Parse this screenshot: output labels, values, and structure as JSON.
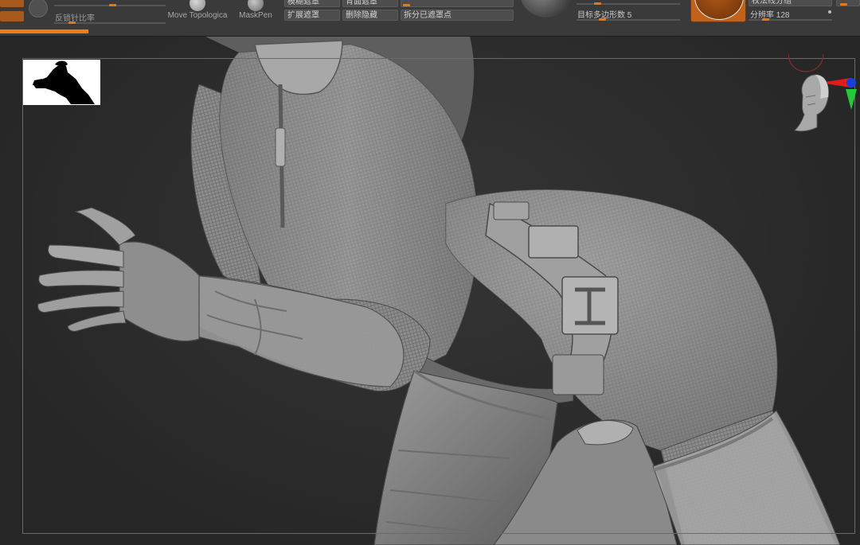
{
  "toolbar": {
    "left_labels": [
      "",
      "反锁针比率"
    ],
    "tools": [
      {
        "label": "Move Topologica"
      },
      {
        "label": "MaskPen"
      }
    ],
    "mask_buttons": [
      "模糊遮罩",
      "背面遮罩",
      "扩展遮罩",
      "删除隐藏",
      "拆分已遮罩点"
    ],
    "target_poly_label": "目标多边形数 5",
    "right_buttons": [
      "权法线分组"
    ],
    "resolution_label": "分辨率 128",
    "colors": {
      "accent": "#ee7d18",
      "panel": "#3a3a3a",
      "viewport": "#2b2b2b",
      "material": "#c0621c"
    }
  },
  "viewport": {
    "icons": [
      "silhouette-thumbnail",
      "head-orientation-icon",
      "axis-gizmo-icon"
    ]
  }
}
